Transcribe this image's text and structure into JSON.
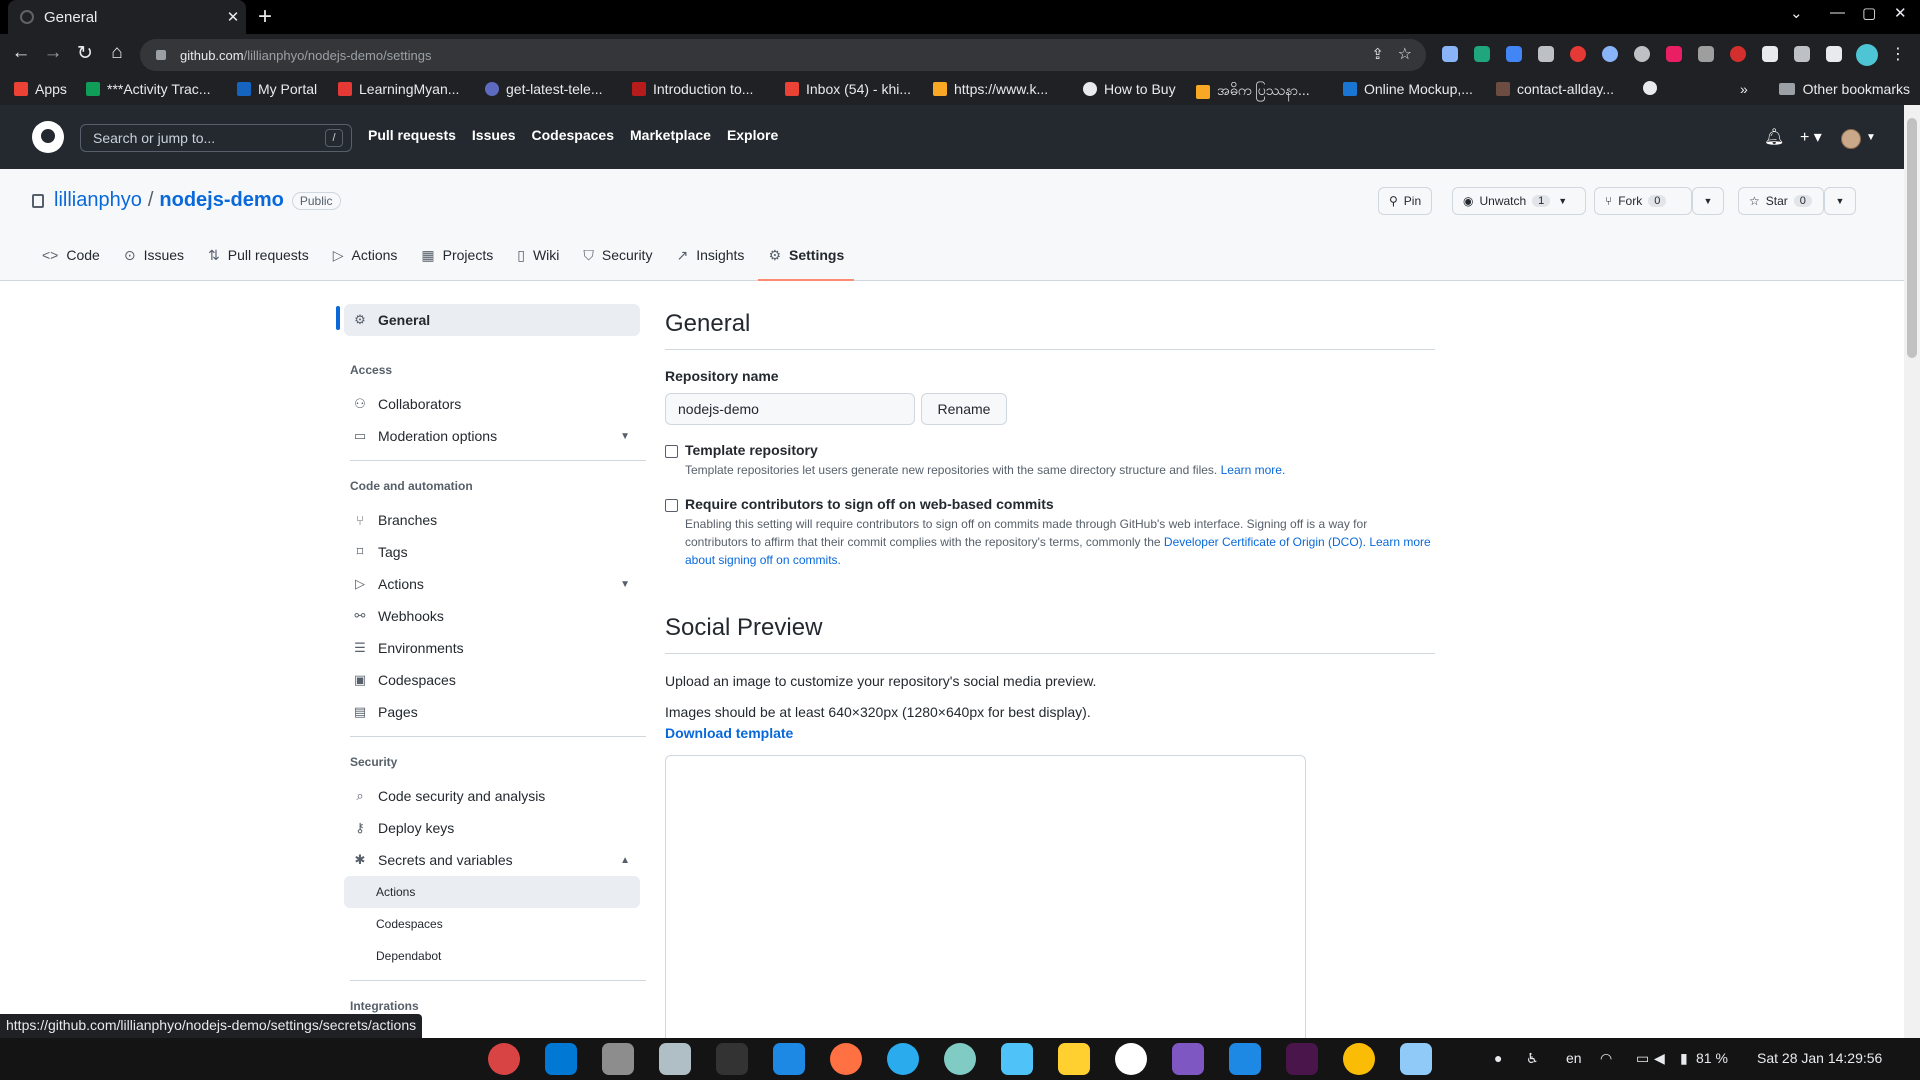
{
  "browser": {
    "tab_title": "General",
    "url_host": "github.com",
    "url_path": "/lillianphyo/nodejs-demo/settings",
    "status_url": "https://github.com/lillianphyo/nodejs-demo/settings/secrets/actions",
    "bookmarks": [
      "Apps",
      "***Activity Trac...",
      "My Portal",
      "LearningMyan...",
      "get-latest-tele...",
      "Introduction to...",
      "Inbox (54) - khi...",
      "https://www.k...",
      "How to Buy",
      "အဓိက ပြဿနာ...",
      "Online Mockup,...",
      "contact-allday..."
    ],
    "bookmarks_overflow": "»",
    "other_bookmarks": "Other bookmarks"
  },
  "github": {
    "search_placeholder": "Search or jump to...",
    "search_key": "/",
    "nav": [
      "Pull requests",
      "Issues",
      "Codespaces",
      "Marketplace",
      "Explore"
    ]
  },
  "repo": {
    "owner": "lillianphyo",
    "name": "nodejs-demo",
    "visibility": "Public",
    "pin": "Pin",
    "unwatch": "Unwatch",
    "watch_count": "1",
    "fork": "Fork",
    "fork_count": "0",
    "star": "Star",
    "star_count": "0",
    "tabs": [
      {
        "label": "Code",
        "icon": "code-icon"
      },
      {
        "label": "Issues",
        "icon": "issue-icon"
      },
      {
        "label": "Pull requests",
        "icon": "pull-request-icon"
      },
      {
        "label": "Actions",
        "icon": "play-icon"
      },
      {
        "label": "Projects",
        "icon": "table-icon"
      },
      {
        "label": "Wiki",
        "icon": "book-icon"
      },
      {
        "label": "Security",
        "icon": "shield-icon"
      },
      {
        "label": "Insights",
        "icon": "graph-icon"
      },
      {
        "label": "Settings",
        "icon": "gear-icon"
      }
    ]
  },
  "sidebar": {
    "general": "General",
    "access_heading": "Access",
    "collaborators": "Collaborators",
    "moderation": "Moderation options",
    "code_heading": "Code and automation",
    "branches": "Branches",
    "tags": "Tags",
    "actions": "Actions",
    "webhooks": "Webhooks",
    "environments": "Environments",
    "codespaces": "Codespaces",
    "pages": "Pages",
    "security_heading": "Security",
    "code_security": "Code security and analysis",
    "deploy_keys": "Deploy keys",
    "secrets": "Secrets and variables",
    "secrets_actions": "Actions",
    "secrets_codespaces": "Codespaces",
    "secrets_dependabot": "Dependabot",
    "integrations_heading": "Integrations"
  },
  "main": {
    "title": "General",
    "repo_name_label": "Repository name",
    "repo_name_value": "nodejs-demo",
    "rename": "Rename",
    "template_label": "Template repository",
    "template_help": "Template repositories let users generate new repositories with the same directory structure and files.",
    "learn_more": "Learn more.",
    "signoff_label": "Require contributors to sign off on web-based commits",
    "signoff_help_1": "Enabling this setting will require contributors to sign off on commits made through GitHub's web interface. Signing off is a way for",
    "signoff_help_2": "contributors to affirm that their commit complies with the repository's terms, commonly the",
    "dco_link": "Developer Certificate of Origin (DCO).",
    "learn_more_signoff_1": "Learn more",
    "learn_more_signoff_2": "about signing off on commits.",
    "social_title": "Social Preview",
    "social_p1": "Upload an image to customize your repository's social media preview.",
    "social_p2": "Images should be at least 640×320px (1280×640px for best display).",
    "download_template": "Download template"
  },
  "taskbar": {
    "lang": "en",
    "battery": "81 %",
    "datetime": "Sat 28 Jan  14:29:56"
  },
  "colors": {
    "link": "#0969da",
    "header_bg": "#24292f",
    "active_tab_underline": "#fd8c73"
  }
}
